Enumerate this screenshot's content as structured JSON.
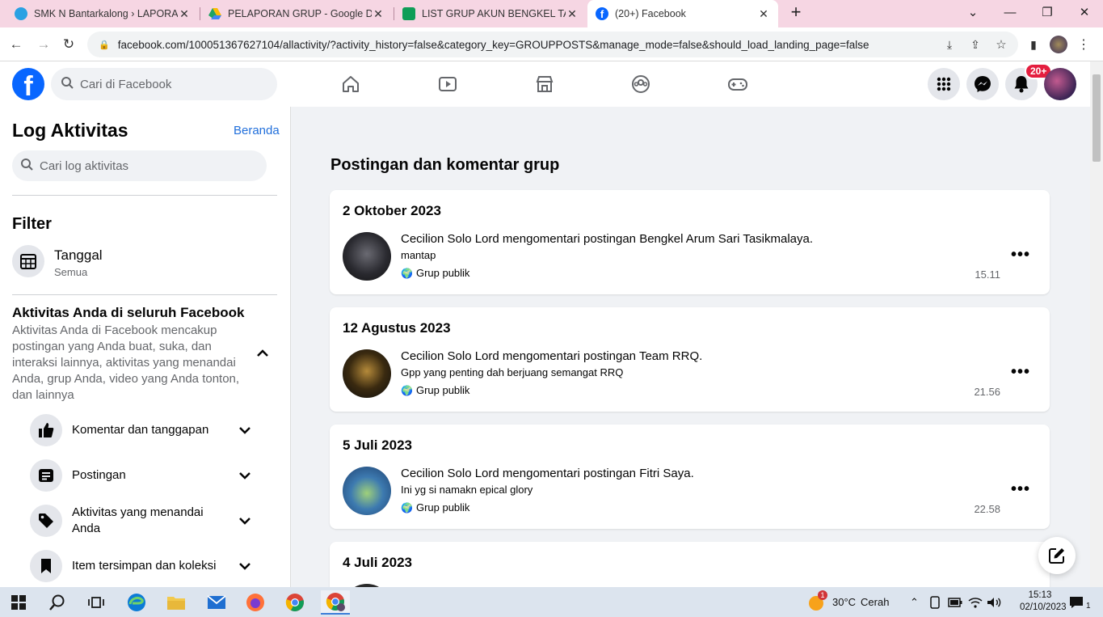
{
  "browser": {
    "tabs": [
      {
        "title": "SMK N Bantarkalong › LAPORAN",
        "favicon_color": "#2aa1e3"
      },
      {
        "title": "PELAPORAN GRUP - Google Dri",
        "favicon_color": "#1fa463"
      },
      {
        "title": "LIST GRUP AKUN BENGKEL TASI",
        "favicon_color": "#0f9d58"
      },
      {
        "title": "(20+) Facebook",
        "favicon_color": "#0866ff"
      }
    ],
    "url": "facebook.com/100051367627104/allactivity/?activity_history=false&category_key=GROUPPOSTS&manage_mode=false&should_load_landing_page=false"
  },
  "fb": {
    "search_placeholder": "Cari di Facebook",
    "notif_badge": "20+",
    "brand_color": "#0866ff"
  },
  "sidebar": {
    "title": "Log Aktivitas",
    "home_link": "Beranda",
    "search_placeholder": "Cari log aktivitas",
    "filter_title": "Filter",
    "date_label": "Tanggal",
    "date_value": "Semua",
    "activity_title": "Aktivitas Anda di seluruh Facebook",
    "activity_desc": "Aktivitas Anda di Facebook mencakup postingan yang Anda buat, suka, dan interaksi lainnya, aktivitas yang menandai Anda, grup Anda, video yang Anda tonton, dan lainnya",
    "items": [
      {
        "label": "Komentar dan tanggapan",
        "icon": "thumbs-up-icon"
      },
      {
        "label": "Postingan",
        "icon": "post-icon"
      },
      {
        "label": "Aktivitas yang menandai Anda",
        "icon": "tag-icon"
      },
      {
        "label": "Item tersimpan dan koleksi",
        "icon": "bookmark-icon"
      }
    ]
  },
  "main": {
    "title": "Postingan dan komentar grup",
    "entries": [
      {
        "date": "2 Oktober 2023",
        "actor": "Cecilion Solo Lord",
        "verb": "mengomentari postingan",
        "target": "Bengkel Arum Sari Tasikmalaya",
        "comment": "mantap",
        "scope": "Grup publik",
        "time": "15.11"
      },
      {
        "date": "12 Agustus 2023",
        "actor": "Cecilion Solo Lord",
        "verb": "mengomentari postingan",
        "target": "Team RRQ",
        "comment": "Gpp yang penting dah berjuang semangat RRQ",
        "scope": "Grup publik",
        "time": "21.56"
      },
      {
        "date": "5 Juli 2023",
        "actor": "Cecilion Solo Lord",
        "verb": "mengomentari postingan",
        "target": "Fitri Saya",
        "comment": "Ini yg si namakn epical glory",
        "scope": "Grup publik",
        "time": "22.58"
      },
      {
        "date": "4 Juli 2023"
      }
    ]
  },
  "taskbar": {
    "weather_temp": "30°C",
    "weather_text": "Cerah",
    "weather_badge": "1",
    "time": "15:13",
    "date": "02/10/2023",
    "notif_count": "1"
  }
}
